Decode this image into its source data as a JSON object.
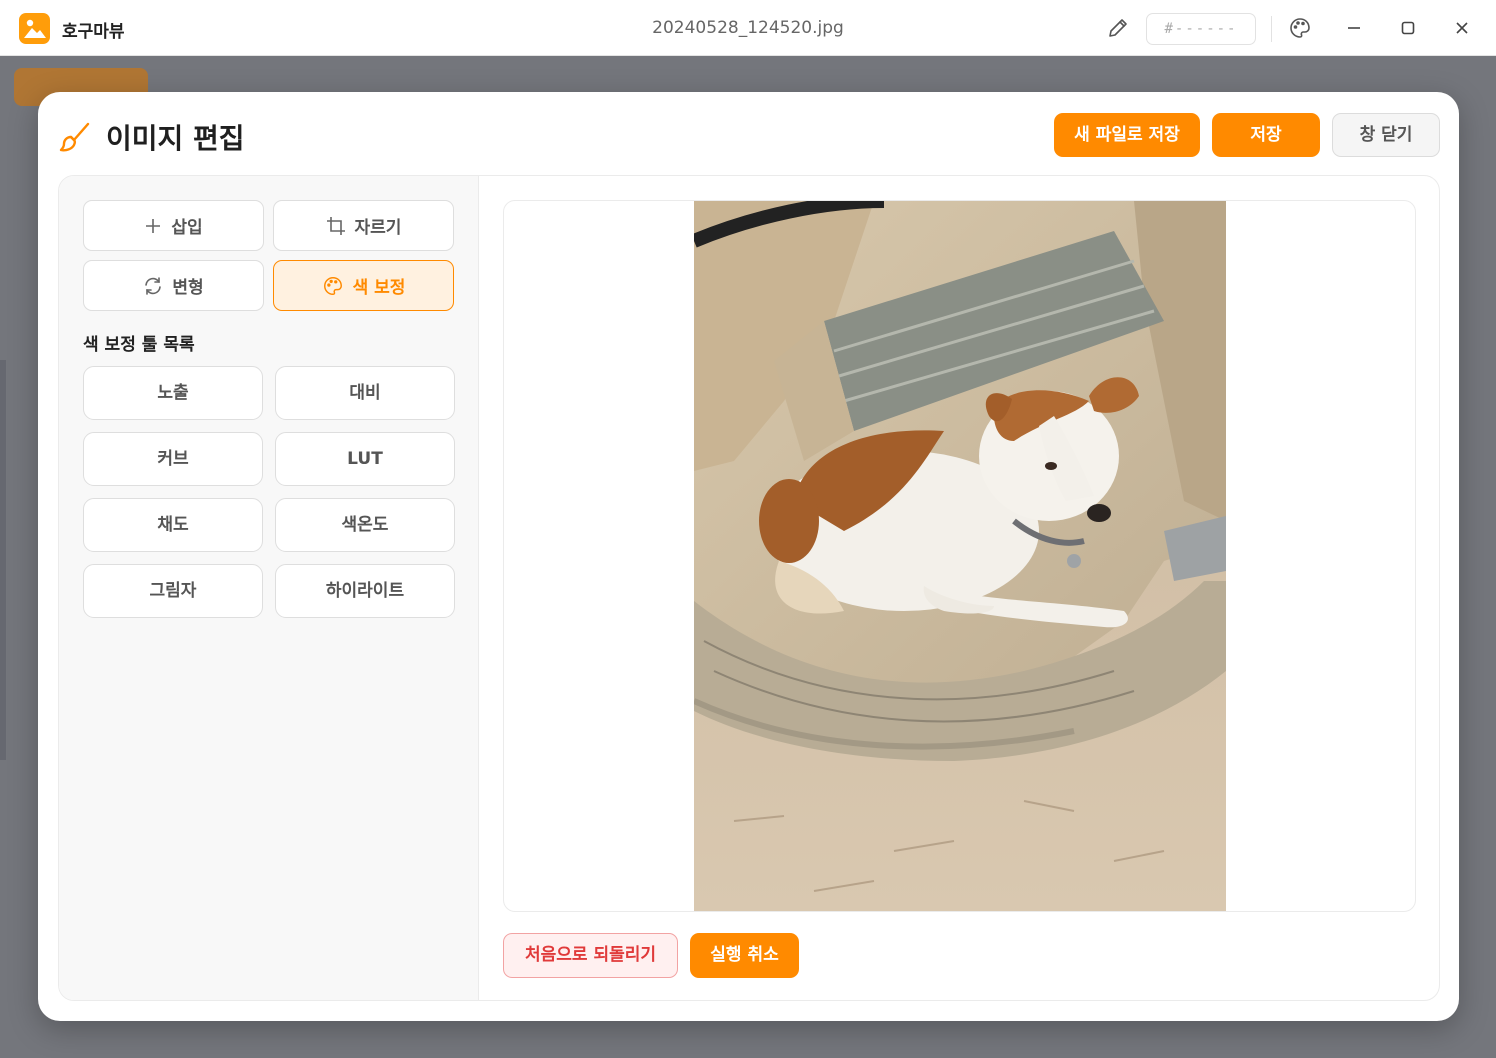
{
  "app": {
    "name": "호구마뷰",
    "file_name": "20240528_124520.jpg",
    "color_code": "#------"
  },
  "window_controls": {
    "pencil": "pencil-icon",
    "palette": "palette-icon",
    "minimize": "minimize-icon",
    "maximize": "maximize-icon",
    "close": "close-icon"
  },
  "modal": {
    "title": "이미지 편집",
    "save_as_new_label": "새 파일로 저장",
    "save_label": "저장",
    "close_label": "창 닫기"
  },
  "tools": {
    "insert": "삽입",
    "crop": "자르기",
    "transform": "변형",
    "color_correction": "색 보정",
    "active": "color_correction"
  },
  "color_tools": {
    "section_title": "색 보정 툴 목록",
    "items": [
      "노출",
      "대비",
      "커브",
      "LUT",
      "채도",
      "색온도",
      "그림자",
      "하이라이트"
    ]
  },
  "actions": {
    "reset_label": "처음으로 되돌리기",
    "undo_label": "실행 취소"
  },
  "colors": {
    "accent": "#ff8a00",
    "danger": "#e03a3a",
    "background_dim": "#6e7077"
  }
}
